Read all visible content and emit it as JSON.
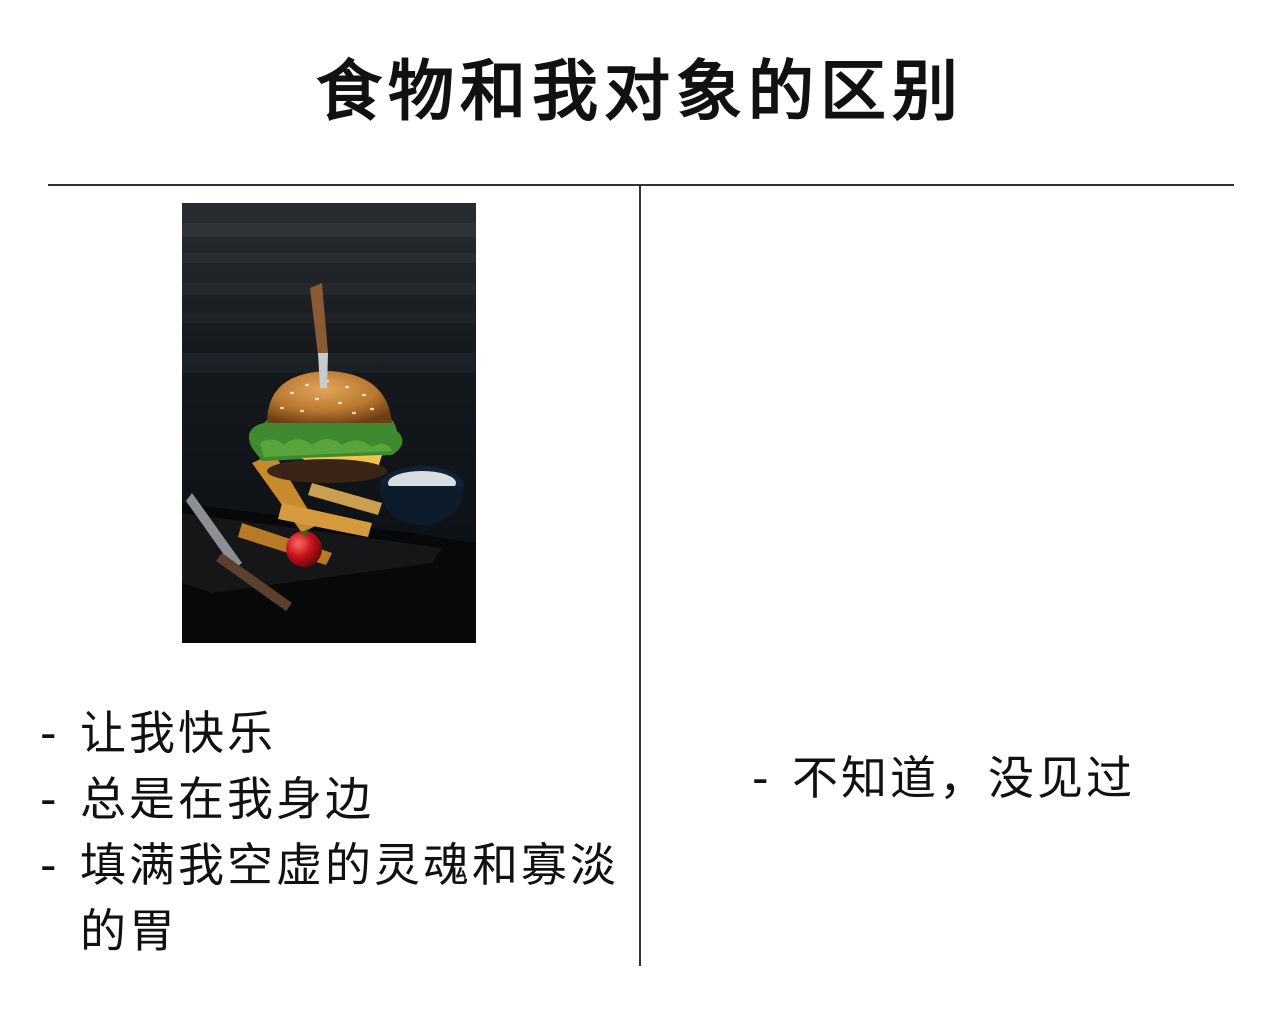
{
  "title": "食物和我对象的区别",
  "left": {
    "items": [
      {
        "dash": "-",
        "text": "让我快乐"
      },
      {
        "dash": "-",
        "text": "总是在我身边"
      },
      {
        "dash": "-",
        "text": "填满我空虚的灵魂和寡淡的胃"
      }
    ]
  },
  "right": {
    "items": [
      {
        "dash": "-",
        "text": "不知道，没见过"
      }
    ]
  },
  "colors": {
    "text": "#111111",
    "lines": "#333333",
    "photo_background": "#0e1115",
    "bun": "#b9772f",
    "lettuce": "#3f8a2e",
    "tomato": "#c8141c"
  }
}
